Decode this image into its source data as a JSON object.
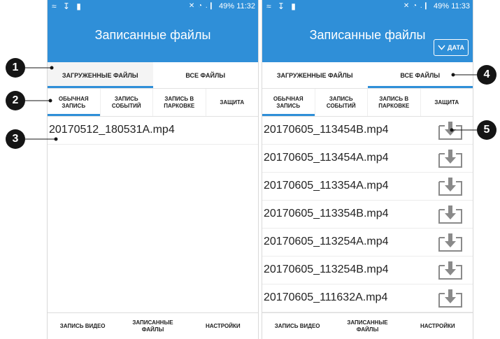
{
  "left_screen": {
    "status": {
      "signal": "✕ ◔ .❙",
      "battery": "49%",
      "time": "11:32"
    },
    "title": "Записанные файлы",
    "tabs": [
      {
        "label": "ЗАГРУЖЕННЫЕ ФАЙЛЫ"
      },
      {
        "label": "ВСЕ ФАЙЛЫ"
      }
    ],
    "subtabs": [
      {
        "label": "ОБЫЧНАЯ\nЗАПИСЬ"
      },
      {
        "label": "ЗАПИСЬ\nСОБЫТИЙ"
      },
      {
        "label": "ЗАПИСЬ В\nПАРКОВКЕ"
      },
      {
        "label": "ЗАЩИТА"
      }
    ],
    "files": [
      {
        "name": "20170512_180531A.mp4"
      }
    ],
    "nav": [
      {
        "label": "ЗАПИСЬ ВИДЕО"
      },
      {
        "label": "ЗАПИСАННЫЕ\nФАЙЛЫ"
      },
      {
        "label": "НАСТРОЙКИ"
      }
    ]
  },
  "right_screen": {
    "status": {
      "signal": "✕ ◔ .❙",
      "battery": "49%",
      "time": "11:33"
    },
    "title": "Записанные файлы",
    "date_button": "ДАТА",
    "tabs": [
      {
        "label": "ЗАГРУЖЕННЫЕ ФАЙЛЫ"
      },
      {
        "label": "ВСЕ ФАЙЛЫ"
      }
    ],
    "subtabs": [
      {
        "label": "ОБЫЧНАЯ\nЗАПИСЬ"
      },
      {
        "label": "ЗАПИСЬ\nСОБЫТИЙ"
      },
      {
        "label": "ЗАПИСЬ В\nПАРКОВКЕ"
      },
      {
        "label": "ЗАЩИТА"
      }
    ],
    "files": [
      {
        "name": "20170605_113454B.mp4"
      },
      {
        "name": "20170605_113454A.mp4"
      },
      {
        "name": "20170605_113354A.mp4"
      },
      {
        "name": "20170605_113354B.mp4"
      },
      {
        "name": "20170605_113254A.mp4"
      },
      {
        "name": "20170605_113254B.mp4"
      },
      {
        "name": "20170605_111632A.mp4"
      }
    ],
    "nav": [
      {
        "label": "ЗАПИСЬ ВИДЕО"
      },
      {
        "label": "ЗАПИСАННЫЕ\nФАЙЛЫ"
      },
      {
        "label": "НАСТРОЙКИ"
      }
    ]
  },
  "callouts": [
    "1",
    "2",
    "3",
    "4",
    "5"
  ],
  "colors": {
    "accent": "#2f8fd8",
    "callout": "#151515",
    "download_icon": "#8a8a8a"
  },
  "icons": {
    "download": "download-icon",
    "date_dropdown": "chevron-down-icon"
  }
}
